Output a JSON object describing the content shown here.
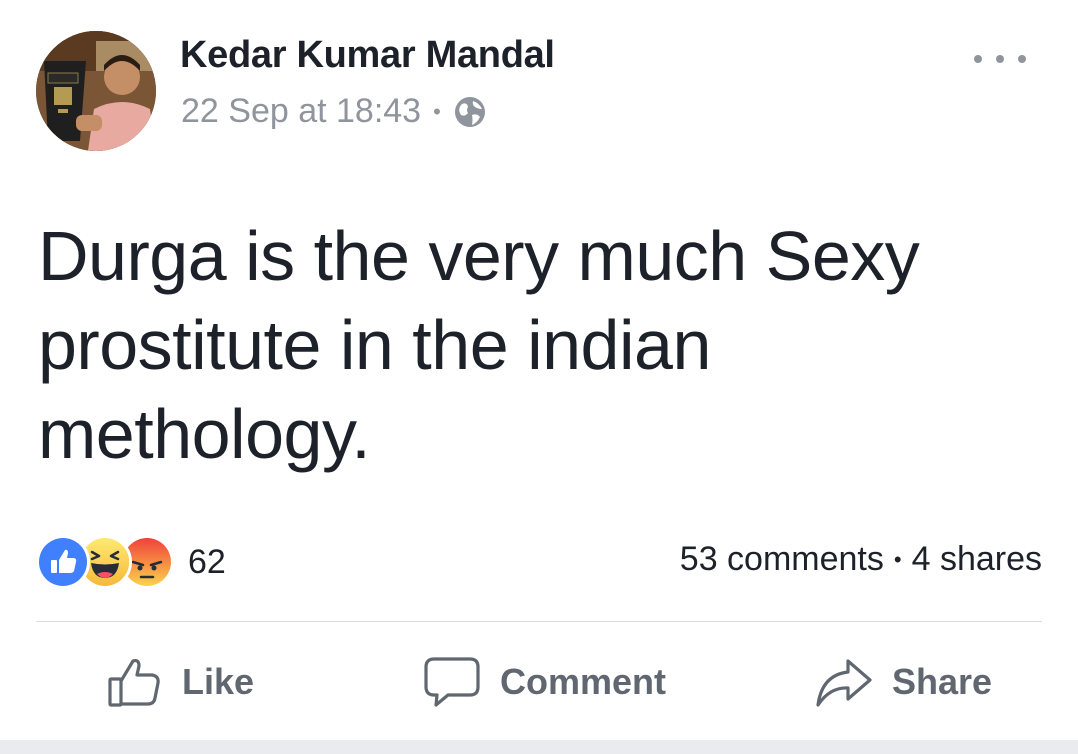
{
  "post": {
    "author": {
      "name": "Kedar Kumar Mandal",
      "avatar_icon": "profile-photo"
    },
    "timestamp": "22 Sep at 18:43",
    "separator": "•",
    "privacy_icon": "globe-icon",
    "menu_icon": "more-options-icon",
    "text": "Durga is the very much Sexy prostitute in the indian methology.",
    "reactions": {
      "types": [
        "like",
        "haha",
        "angry"
      ],
      "count": "62",
      "colors": {
        "like": "#4080ff",
        "haha": "#fcd34d",
        "angry": "#f46a3e"
      }
    },
    "stats": {
      "comments": "53 comments",
      "separator": "•",
      "shares": "4 shares"
    },
    "actions": {
      "like_label": "Like",
      "comment_label": "Comment",
      "share_label": "Share"
    }
  },
  "theme": {
    "text": "#1d2129",
    "muted": "#90949c",
    "action": "#606770",
    "divider": "#dadde1",
    "footer": "#e9ebee"
  }
}
